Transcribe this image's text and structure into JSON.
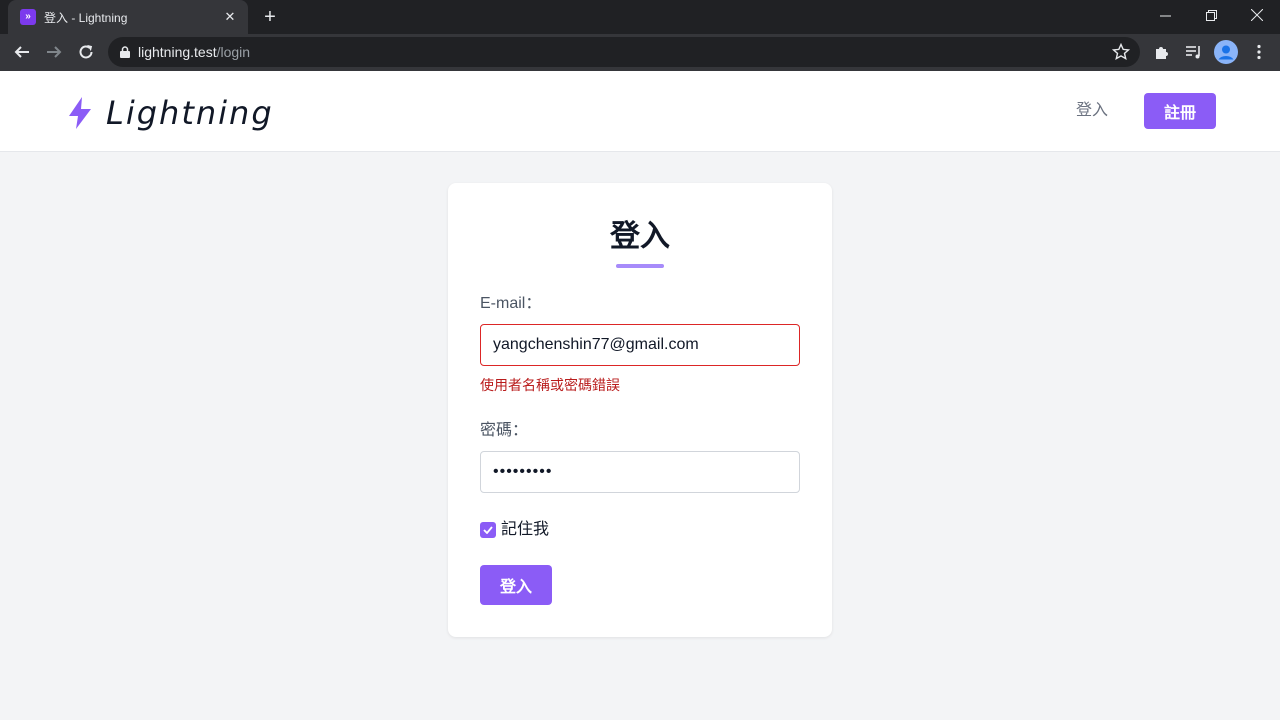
{
  "browser": {
    "tab_title": "登入 - Lightning",
    "url_host": "lightning.test",
    "url_path": "/login"
  },
  "header": {
    "logo_text": "Lightning",
    "login_label": "登入",
    "register_label": "註冊"
  },
  "form": {
    "title": "登入",
    "email_label": "E-mail：",
    "email_value": "yangchenshin77@gmail.com",
    "email_error": "使用者名稱或密碼錯誤",
    "password_label": "密碼：",
    "password_value": "•••••••••",
    "remember_label": "記住我",
    "remember_checked": true,
    "submit_label": "登入"
  },
  "colors": {
    "accent": "#8b5cf6",
    "error": "#dc2626"
  }
}
